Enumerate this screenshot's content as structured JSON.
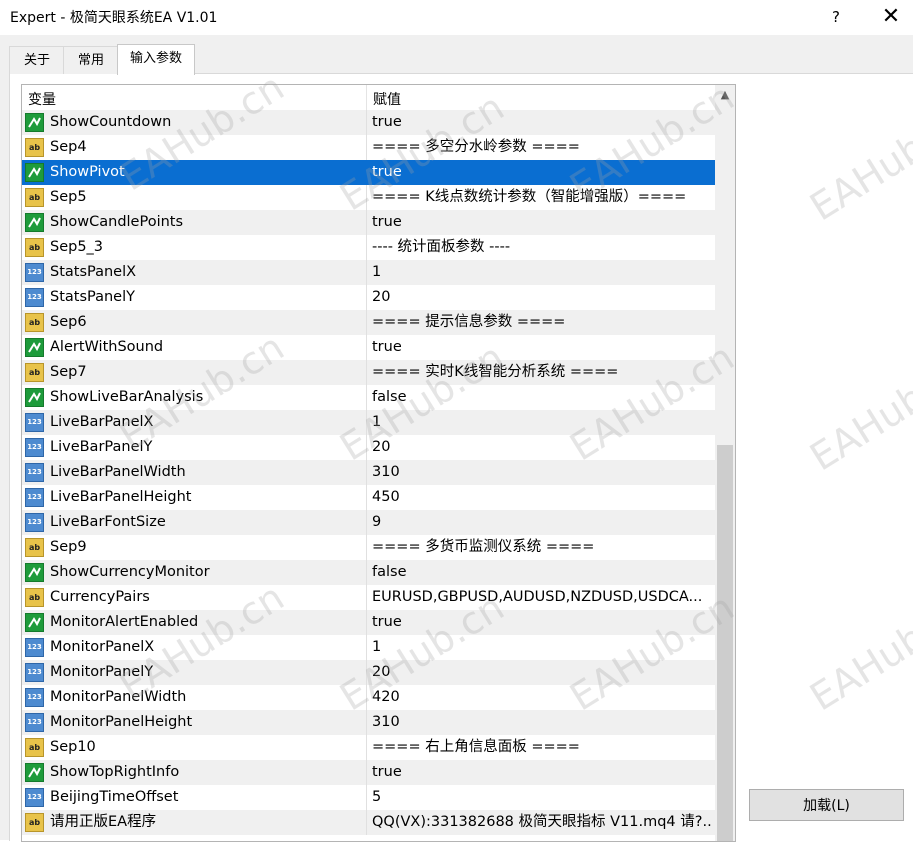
{
  "window": {
    "title": "Expert - 极简天眼系统EA V1.01",
    "help": "?",
    "close": "✕"
  },
  "tabs": [
    {
      "label": "关于"
    },
    {
      "label": "常用"
    },
    {
      "label": "输入参数"
    }
  ],
  "grid": {
    "headers": {
      "variable": "变量",
      "value": "赋值"
    },
    "rows": [
      {
        "type": "bool",
        "name": "ShowCountdown",
        "value": "true"
      },
      {
        "type": "str",
        "name": "Sep4",
        "value": "==== 多空分水岭参数 ===="
      },
      {
        "type": "bool",
        "name": "ShowPivot",
        "value": "true",
        "selected": true
      },
      {
        "type": "str",
        "name": "Sep5",
        "value": "==== K线点数统计参数（智能增强版）===="
      },
      {
        "type": "bool",
        "name": "ShowCandlePoints",
        "value": "true"
      },
      {
        "type": "str",
        "name": "Sep5_3",
        "value": "---- 统计面板参数 ----"
      },
      {
        "type": "num",
        "name": "StatsPanelX",
        "value": "1"
      },
      {
        "type": "num",
        "name": "StatsPanelY",
        "value": "20"
      },
      {
        "type": "str",
        "name": "Sep6",
        "value": "==== 提示信息参数 ===="
      },
      {
        "type": "bool",
        "name": "AlertWithSound",
        "value": "true"
      },
      {
        "type": "str",
        "name": "Sep7",
        "value": "==== 实时K线智能分析系统 ===="
      },
      {
        "type": "bool",
        "name": "ShowLiveBarAnalysis",
        "value": "false"
      },
      {
        "type": "num",
        "name": "LiveBarPanelX",
        "value": "1"
      },
      {
        "type": "num",
        "name": "LiveBarPanelY",
        "value": "20"
      },
      {
        "type": "num",
        "name": "LiveBarPanelWidth",
        "value": "310"
      },
      {
        "type": "num",
        "name": "LiveBarPanelHeight",
        "value": "450"
      },
      {
        "type": "num",
        "name": "LiveBarFontSize",
        "value": "9"
      },
      {
        "type": "str",
        "name": "Sep9",
        "value": "==== 多货币监测仪系统 ===="
      },
      {
        "type": "bool",
        "name": "ShowCurrencyMonitor",
        "value": "false"
      },
      {
        "type": "str",
        "name": "CurrencyPairs",
        "value": "EURUSD,GBPUSD,AUDUSD,NZDUSD,USDCA..."
      },
      {
        "type": "bool",
        "name": "MonitorAlertEnabled",
        "value": "true"
      },
      {
        "type": "num",
        "name": "MonitorPanelX",
        "value": "1"
      },
      {
        "type": "num",
        "name": "MonitorPanelY",
        "value": "20"
      },
      {
        "type": "num",
        "name": "MonitorPanelWidth",
        "value": "420"
      },
      {
        "type": "num",
        "name": "MonitorPanelHeight",
        "value": "310"
      },
      {
        "type": "str",
        "name": "Sep10",
        "value": "==== 右上角信息面板 ===="
      },
      {
        "type": "bool",
        "name": "ShowTopRightInfo",
        "value": "true"
      },
      {
        "type": "num",
        "name": "BeijingTimeOffset",
        "value": "5"
      },
      {
        "type": "str",
        "name": "请用正版EA程序",
        "value": "QQ(VX):331382688 极简天眼指标 V11.mq4 请?.."
      }
    ]
  },
  "buttons": {
    "load": "加载(L)"
  },
  "watermark": "EAHub.cn",
  "icons": {
    "bool": "bool-icon",
    "str": "string-ab-icon",
    "num": "number-123-icon"
  },
  "colors": {
    "selection": "#0a6ed1",
    "bool_icon": "#1e9b3b",
    "str_icon": "#e8c34a",
    "num_icon": "#4e8bd0"
  }
}
